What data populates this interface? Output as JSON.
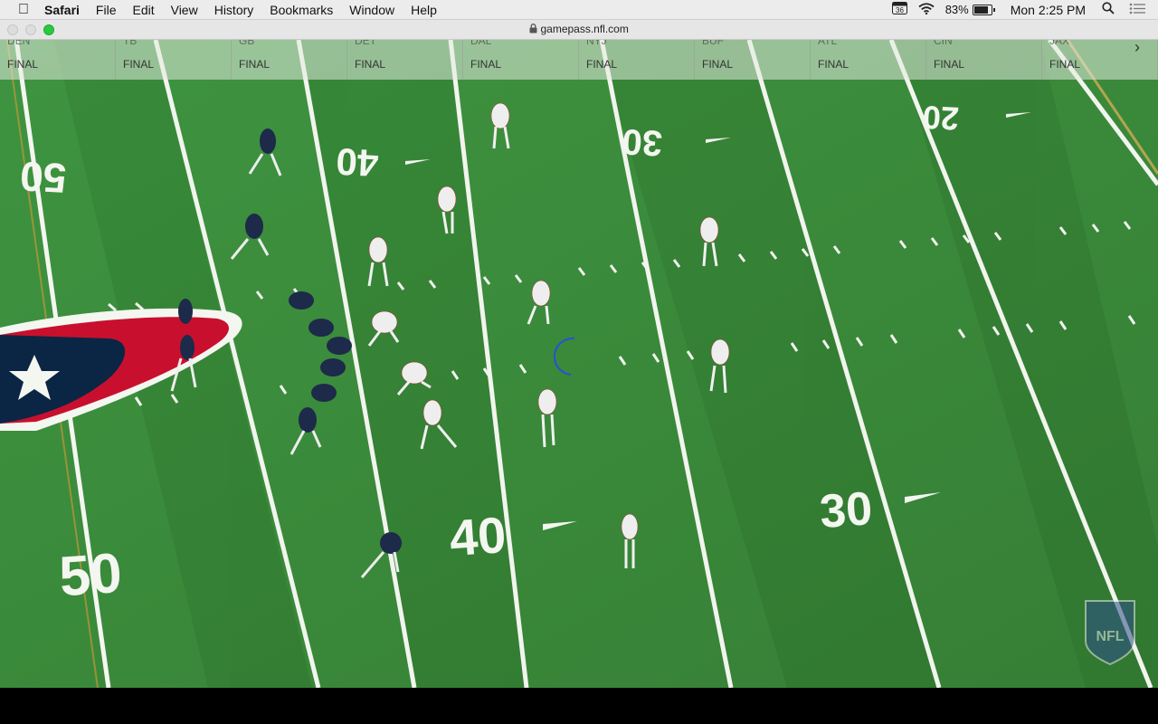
{
  "menubar": {
    "apple_icon": "apple-icon",
    "app_name": "Safari",
    "menus": [
      "File",
      "Edit",
      "View",
      "History",
      "Bookmarks",
      "Window",
      "Help"
    ],
    "battery_percent": "83%",
    "battery_level": 0.83,
    "clock": "Mon 2:25 PM"
  },
  "toolbar": {
    "url": "gamepass.nfl.com"
  },
  "scorebar": {
    "games": [
      {
        "team": "DEN",
        "status": "FINAL"
      },
      {
        "team": "TB",
        "status": "FINAL"
      },
      {
        "team": "GB",
        "status": "FINAL"
      },
      {
        "team": "DET",
        "status": "FINAL"
      },
      {
        "team": "DAL",
        "status": "FINAL"
      },
      {
        "team": "NYJ",
        "status": "FINAL"
      },
      {
        "team": "BUF",
        "status": "FINAL"
      },
      {
        "team": "ATL",
        "status": "FINAL"
      },
      {
        "team": "CIN",
        "status": "FINAL"
      },
      {
        "team": "JAX",
        "status": "FINAL"
      }
    ]
  },
  "field": {
    "yard_numbers": [
      "50",
      "40",
      "30",
      "20"
    ],
    "watermark": "NFL",
    "colors": {
      "grass": "#3d8f3a",
      "grass_dark": "#367f33",
      "line": "#f4f6f0",
      "texans_navy": "#0b2545",
      "texans_red": "#c8102e",
      "away_jersey": "#f1f1f1",
      "away_trim": "#b3262e"
    }
  }
}
